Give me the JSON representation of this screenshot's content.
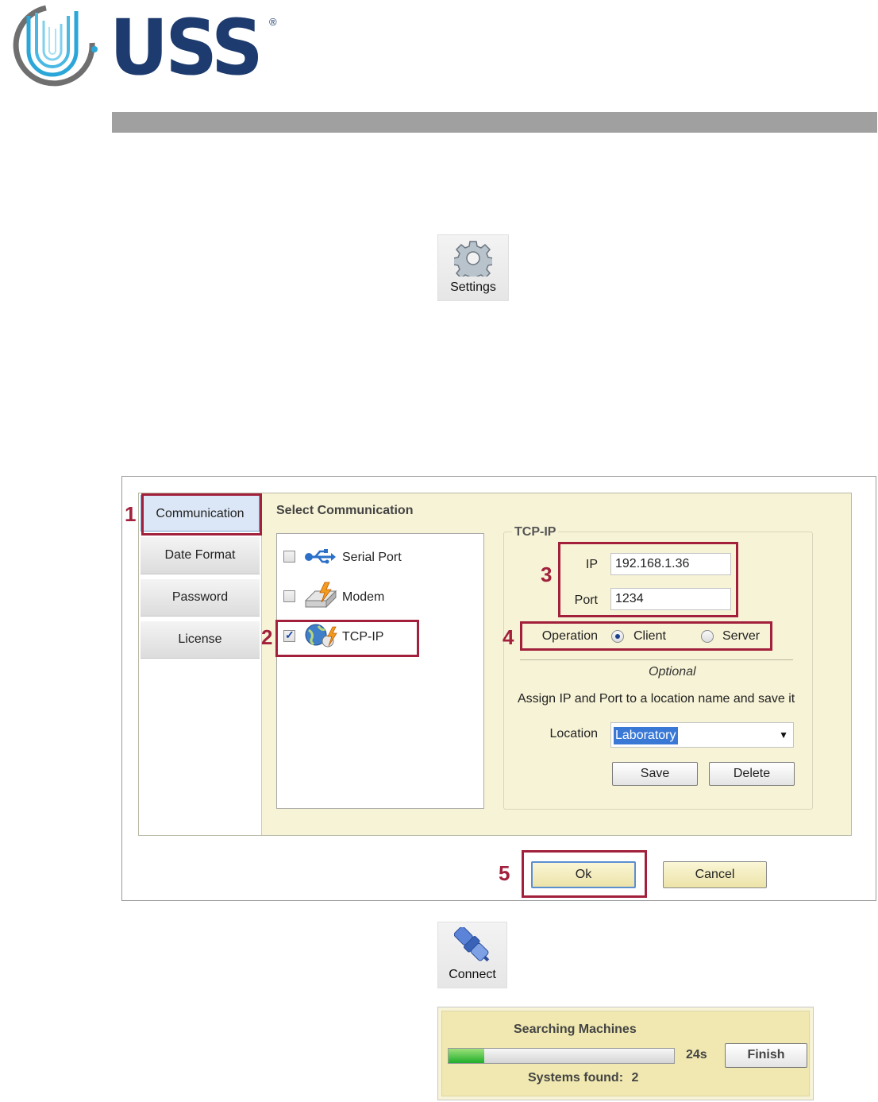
{
  "brand": {
    "logo_text": "USS",
    "registered": "®"
  },
  "toolbar": {
    "settings_label": "Settings",
    "connect_label": "Connect"
  },
  "dialog": {
    "tabs": [
      {
        "label": "Communication",
        "active": true
      },
      {
        "label": "Date Format"
      },
      {
        "label": "Password"
      },
      {
        "label": "License"
      }
    ],
    "select_title": "Select Communication",
    "comm_options": [
      {
        "label": "Serial Port",
        "checked": false,
        "icon": "usb-icon"
      },
      {
        "label": "Modem",
        "checked": false,
        "icon": "modem-icon"
      },
      {
        "label": "TCP-IP",
        "checked": true,
        "icon": "network-globe-icon"
      }
    ],
    "tcp": {
      "legend": "TCP-IP",
      "ip_label": "IP",
      "ip_value": "192.168.1.36",
      "port_label": "Port",
      "port_value": "1234",
      "operation_label": "Operation",
      "client_label": "Client",
      "server_label": "Server",
      "operation_selected": "Client",
      "optional_label": "Optional",
      "assign_text": "Assign IP and Port to a location name and save it",
      "location_label": "Location",
      "location_value": "Laboratory",
      "save_label": "Save",
      "delete_label": "Delete"
    },
    "ok_label": "Ok",
    "cancel_label": "Cancel"
  },
  "annotations": [
    "1",
    "2",
    "3",
    "4",
    "5"
  ],
  "search": {
    "title": "Searching Machines",
    "progress": 0.16,
    "elapsed": "24s",
    "finish_label": "Finish",
    "found_label": "Systems found:",
    "found_count": "2"
  },
  "colors": {
    "brand_blue": "#1d3b6e",
    "annotation_red": "#a2203c",
    "panel_yellow": "#f7f3d6",
    "header_gray": "#a0a0a0"
  }
}
